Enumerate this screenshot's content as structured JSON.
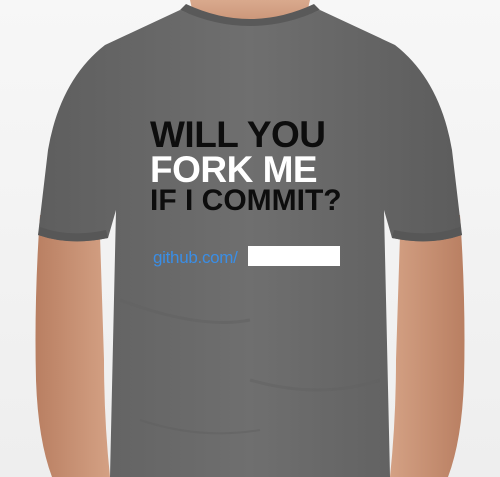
{
  "shirt": {
    "color": "#6b6b6b",
    "slogan": {
      "line1": "WILL YOU",
      "line2": "FORK ME",
      "line3": "IF I COMMIT?",
      "dark_color": "#0d0d0d",
      "light_color": "#ffffff"
    },
    "url": {
      "text": "github.com/",
      "color": "#3a8ee6",
      "blank_box_color": "#ffffff"
    }
  },
  "background_color": "#f4f4f4",
  "skin_color": "#c9967a"
}
